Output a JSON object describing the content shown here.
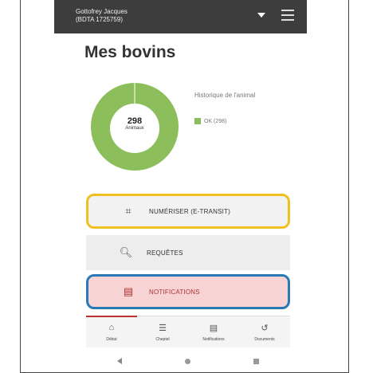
{
  "header": {
    "user_line1": "Gottofrey Jacques",
    "user_line2": "(BDTA 1725759)"
  },
  "page_title": "Mes bovins",
  "donut": {
    "count": "298",
    "unit": "Animaux",
    "color": "#8cbf5c"
  },
  "legend": {
    "title": "Historique de l'animal",
    "item": "OK (298)"
  },
  "actions": {
    "scan": "NUMÉRISER (E-TRANSIT)",
    "requests": "REQUÊTES",
    "notifications": "NOTIFICATIONS"
  },
  "tabs": [
    {
      "label": "Début",
      "icon": "home-icon"
    },
    {
      "label": "Cheptel",
      "icon": "list-icon"
    },
    {
      "label": "Notifications",
      "icon": "notification-icon"
    },
    {
      "label": "Documents",
      "icon": "history-icon"
    }
  ],
  "colors": {
    "appbar": "#3d3d3d",
    "scan_highlight": "#f0c020",
    "notif_highlight": "#2a7ab5",
    "notif_bg": "#f7d3d3"
  }
}
